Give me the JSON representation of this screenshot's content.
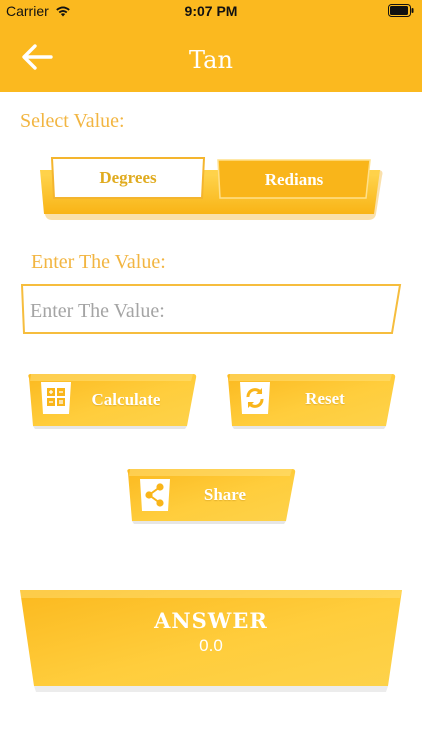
{
  "status_bar": {
    "carrier": "Carrier",
    "time": "9:07 PM"
  },
  "nav": {
    "title": "Tan"
  },
  "select_value": {
    "label": "Select Value:",
    "options": [
      {
        "label": "Degrees",
        "selected": false
      },
      {
        "label": "Redians",
        "selected": true
      }
    ]
  },
  "enter_value": {
    "label": "Enter The Value:",
    "placeholder": "Enter The Value:"
  },
  "buttons": {
    "calculate": "Calculate",
    "reset": "Reset",
    "share": "Share"
  },
  "answer": {
    "title": "ANSWER",
    "value": "0.0"
  },
  "colors": {
    "primary": "#fbb91f",
    "accent_text": "#f2b541",
    "white": "#ffffff"
  },
  "icons": {
    "back": "arrow-left-icon",
    "calculate": "calculator-icon",
    "reset": "refresh-icon",
    "share": "share-icon",
    "wifi": "wifi-icon",
    "battery": "battery-icon"
  }
}
